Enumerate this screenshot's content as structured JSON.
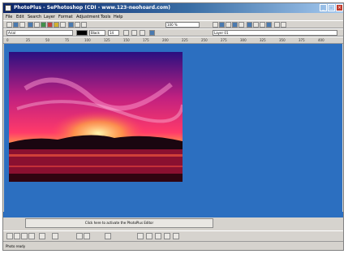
{
  "window": {
    "title": "PhotoPlus - SePhotoshop (CDI - www.123-neohoard.com)"
  },
  "menu": {
    "items": [
      "File",
      "Edit",
      "Search",
      "Layer",
      "Format",
      "Adjustment",
      "Tools",
      "Help"
    ]
  },
  "toolbar": {
    "zoom_value": "100 %",
    "size_value": "Anti-Ali"
  },
  "format_bar": {
    "font_value": "Arial",
    "size_value": "14",
    "style_value": "Black",
    "layer_value": "Layer 01"
  },
  "ruler": {
    "ticks": [
      "0",
      "25",
      "50",
      "75",
      "100",
      "125",
      "150",
      "175",
      "200",
      "225",
      "250",
      "275",
      "300",
      "325",
      "350",
      "375",
      "400"
    ]
  },
  "panel": {
    "button_label": "Click here to activate the PhotoPlus Editor"
  },
  "status": {
    "text": "Photo ready"
  },
  "colors": {
    "canvas": "#2c6fc0",
    "titlebar_start": "#0a246a",
    "titlebar_end": "#a6caf0"
  }
}
